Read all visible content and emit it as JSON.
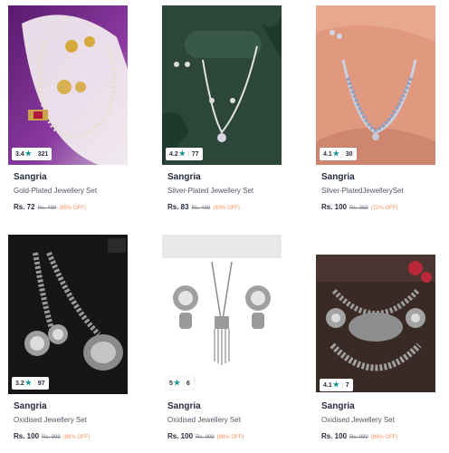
{
  "products": [
    {
      "rating": "3.4",
      "count": "321",
      "brand": "Sangria",
      "title": "Gold-Plated Jewellery Set",
      "price": "Rs. 72",
      "mrp": "Rs. 499",
      "discount": "(85% OFF)",
      "icon": "gold-necklace-image"
    },
    {
      "rating": "4.2",
      "count": "77",
      "brand": "Sangria",
      "title": "Silver-Plated Jewellery Set",
      "price": "Rs. 83",
      "mrp": "Rs. 499",
      "discount": "(83% OFF)",
      "icon": "silver-necklace-image"
    },
    {
      "rating": "4.1",
      "count": "30",
      "brand": "Sangria",
      "title": "Silver-PlatedJewellerySet",
      "price": "Rs. 100",
      "mrp": "Rs. 359",
      "discount": "(72% OFF)",
      "icon": "blue-stone-necklace-image"
    },
    {
      "rating": "3.2",
      "count": "97",
      "brand": "Sangria",
      "title": "Oxidised Jewellery Set",
      "price": "Rs. 100",
      "mrp": "Rs. 999",
      "discount": "(89% OFF)",
      "icon": "oxidised-long-necklace-image"
    },
    {
      "rating": "5",
      "count": "6",
      "brand": "Sangria",
      "title": "Oxidised Jewellery Set",
      "price": "Rs. 100",
      "mrp": "Rs. 999",
      "discount": "(89% OFF)",
      "icon": "oxidised-tassel-necklace-image"
    },
    {
      "rating": "4.1",
      "count": "7",
      "brand": "Sangria",
      "title": "Oxidised Jewellery Set",
      "price": "Rs. 100",
      "mrp": "Rs. 999",
      "discount": "(89% OFF)",
      "icon": "oxidised-choker-set-image"
    }
  ],
  "colors": {
    "accent_star": "#14958f",
    "discount": "#ff905a",
    "text": "#282c3f"
  }
}
